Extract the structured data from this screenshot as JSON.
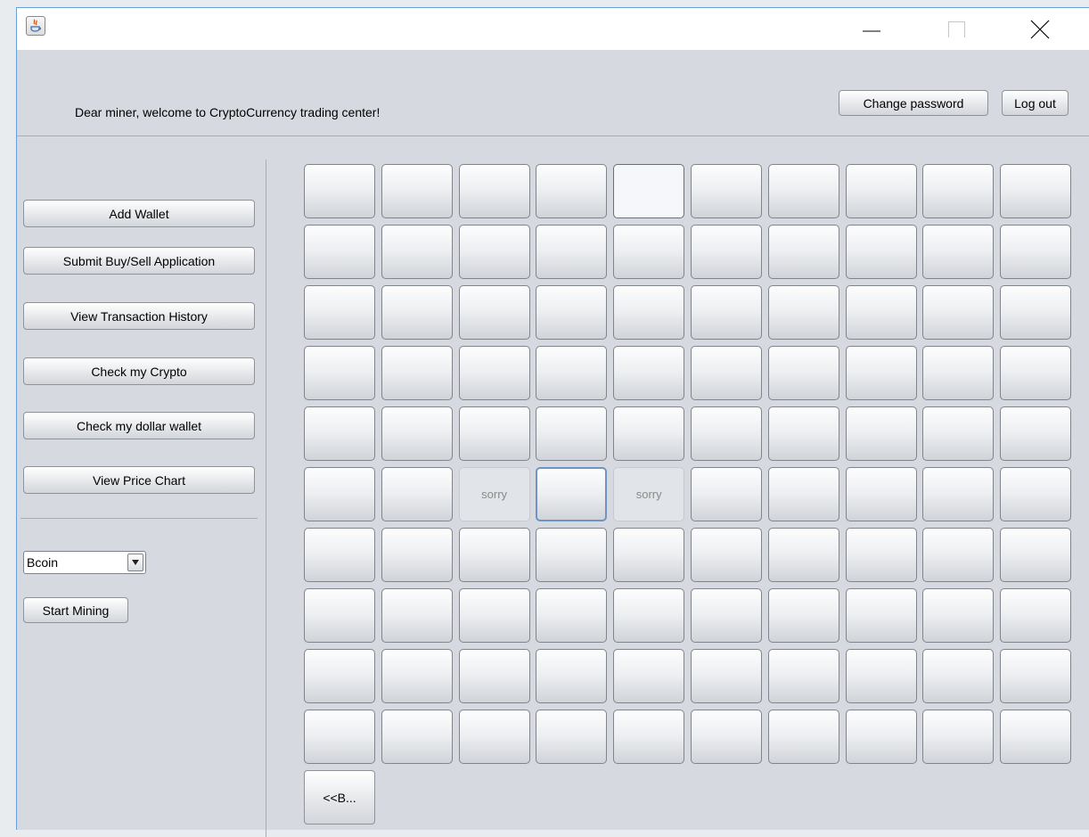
{
  "window": {
    "controls": {
      "minimize_icon": "minimize-icon",
      "maximize_icon": "maximize-icon",
      "close_icon": "close-icon"
    }
  },
  "header": {
    "welcome": "Dear miner, welcome to CryptoCurrency trading center!",
    "change_password": "Change password",
    "log_out": "Log out"
  },
  "sidebar": {
    "buttons": [
      "Add Wallet",
      "Submit Buy/Sell Application",
      "View Transaction History",
      "Check my Crypto",
      "Check my dollar wallet",
      "View Price Chart"
    ],
    "coin_select": {
      "value": "Bcoin"
    },
    "start_mining": "Start Mining"
  },
  "grid": {
    "rows": 10,
    "cols": 10,
    "cells": {
      "0-4": {
        "label": "",
        "state": "highlight"
      },
      "5-2": {
        "label": "sorry",
        "state": "disabled"
      },
      "5-3": {
        "label": "",
        "state": "focused"
      },
      "5-4": {
        "label": "sorry",
        "state": "disabled"
      }
    },
    "back_label": "<<B..."
  },
  "colors": {
    "accent_border": "#6aa0d8",
    "panel_bg": "#d6d9df"
  }
}
